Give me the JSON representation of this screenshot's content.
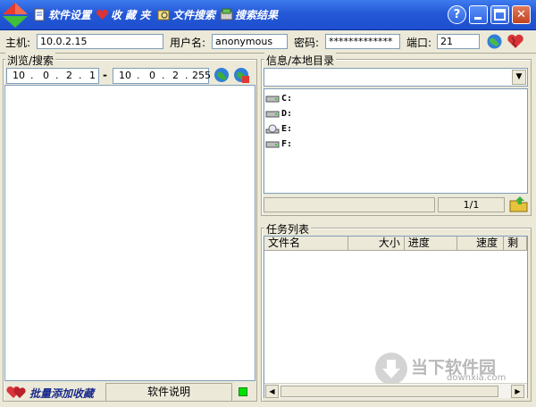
{
  "menu": [
    {
      "label": "软件设置",
      "icon": "settings-doc-icon"
    },
    {
      "label": "收 藏 夹",
      "icon": "heart-favorites-icon"
    },
    {
      "label": "文件搜索",
      "icon": "file-search-icon"
    },
    {
      "label": "搜索结果",
      "icon": "search-results-icon"
    }
  ],
  "window_buttons": {
    "help": "?",
    "close": "✕"
  },
  "connection": {
    "host_label": "主机:",
    "host_value": "10.0.2.15",
    "user_label": "用户名:",
    "user_value": "anonymous",
    "pass_label": "密码:",
    "pass_value": "*************",
    "port_label": "端口:",
    "port_value": "21"
  },
  "browse": {
    "title": "浏览/搜索",
    "ip_start": [
      "10",
      ".",
      "0",
      ".",
      "2",
      ".",
      "1"
    ],
    "dash": "-",
    "ip_end": [
      "10",
      ".",
      "0",
      ".",
      "2",
      ".",
      "255"
    ]
  },
  "info": {
    "title": "信息/本地目录",
    "drives": [
      "C:",
      "D:",
      "E:",
      "F:"
    ],
    "page": "1/1"
  },
  "tasks": {
    "title": "任务列表",
    "columns": [
      "文件名",
      "大小",
      "进度",
      "速度",
      "剩"
    ]
  },
  "bottom": {
    "batch_label": "批量添加收藏",
    "help_label": "软件说明",
    "status_color": "#00e000"
  },
  "watermark": {
    "cn": "当下软件园",
    "url": "downxia.com"
  },
  "colors": {
    "title_blue": "#2458d6",
    "status_green": "#00e000"
  }
}
